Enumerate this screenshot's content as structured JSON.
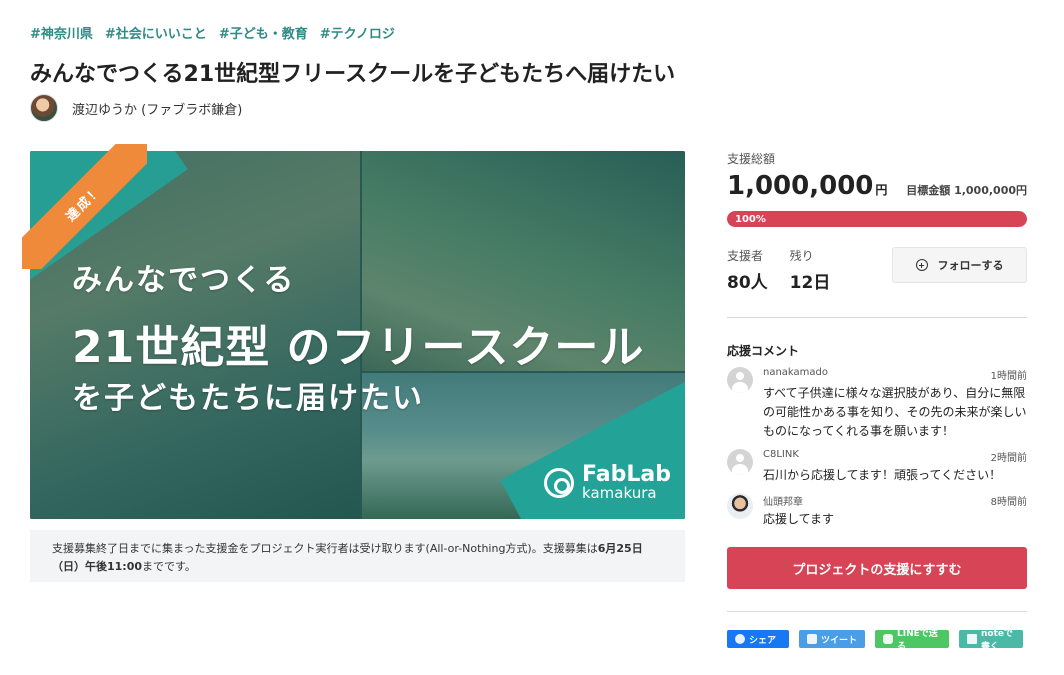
{
  "tags": [
    "#神奈川県",
    "#社会にいいこと",
    "#子ども・教育",
    "#テクノロジ"
  ],
  "project": {
    "title": "みんなでつくる21世紀型フリースクールを子どもたちへ届けたい",
    "owner": "渡辺ゆうか (ファブラボ鎌倉)"
  },
  "hero": {
    "ribbon": "達成！",
    "line1": "みんなでつくる",
    "line2": "21世紀型 のフリースクール",
    "line3": "を子どもたちに届けたい",
    "logo_main": "FabLab",
    "logo_sub": "kamakura"
  },
  "notice": {
    "text1": "支援募集終了日までに集まった支援金をプロジェクト実行者は受け取ります(All-or-Nothing方式)。支援募集は",
    "strong": "6月25日（日）午後11:00",
    "text2": "までです。"
  },
  "funding": {
    "total_label": "支援総額",
    "total_amount": "1,000,000",
    "total_unit": "円",
    "goal_text": "目標金額 1,000,000円",
    "progress_label": "100%",
    "progress": 1.0,
    "supporters_label": "支援者",
    "supporters_value": "80人",
    "remaining_label": "残り",
    "remaining_value": "12日",
    "follow_label": "フォローする"
  },
  "comments": {
    "title": "応援コメント",
    "items": [
      {
        "user": "nanakamado",
        "time": "1時間前",
        "text": "すべて子供達に様々な選択肢があり、自分に無限の可能性かある事を知り、その先の未来が楽しいものになってくれる事を願います！"
      },
      {
        "user": "C8LINK",
        "time": "2時間前",
        "text": "石川から応援してます！頑張ってください！"
      },
      {
        "user": "仙頭邦章",
        "time": "8時間前",
        "text": "応援してます"
      }
    ]
  },
  "cta": {
    "support_label": "プロジェクトの支援にすすむ"
  },
  "share": {
    "facebook": "シェア",
    "twitter": "ツイート",
    "line": "LINEで送る",
    "note": "noteで書く"
  },
  "colors": {
    "accent": "#d64455",
    "tag": "#2e8b85",
    "ribbon": "#ee8a3a",
    "teal": "#23a398"
  }
}
